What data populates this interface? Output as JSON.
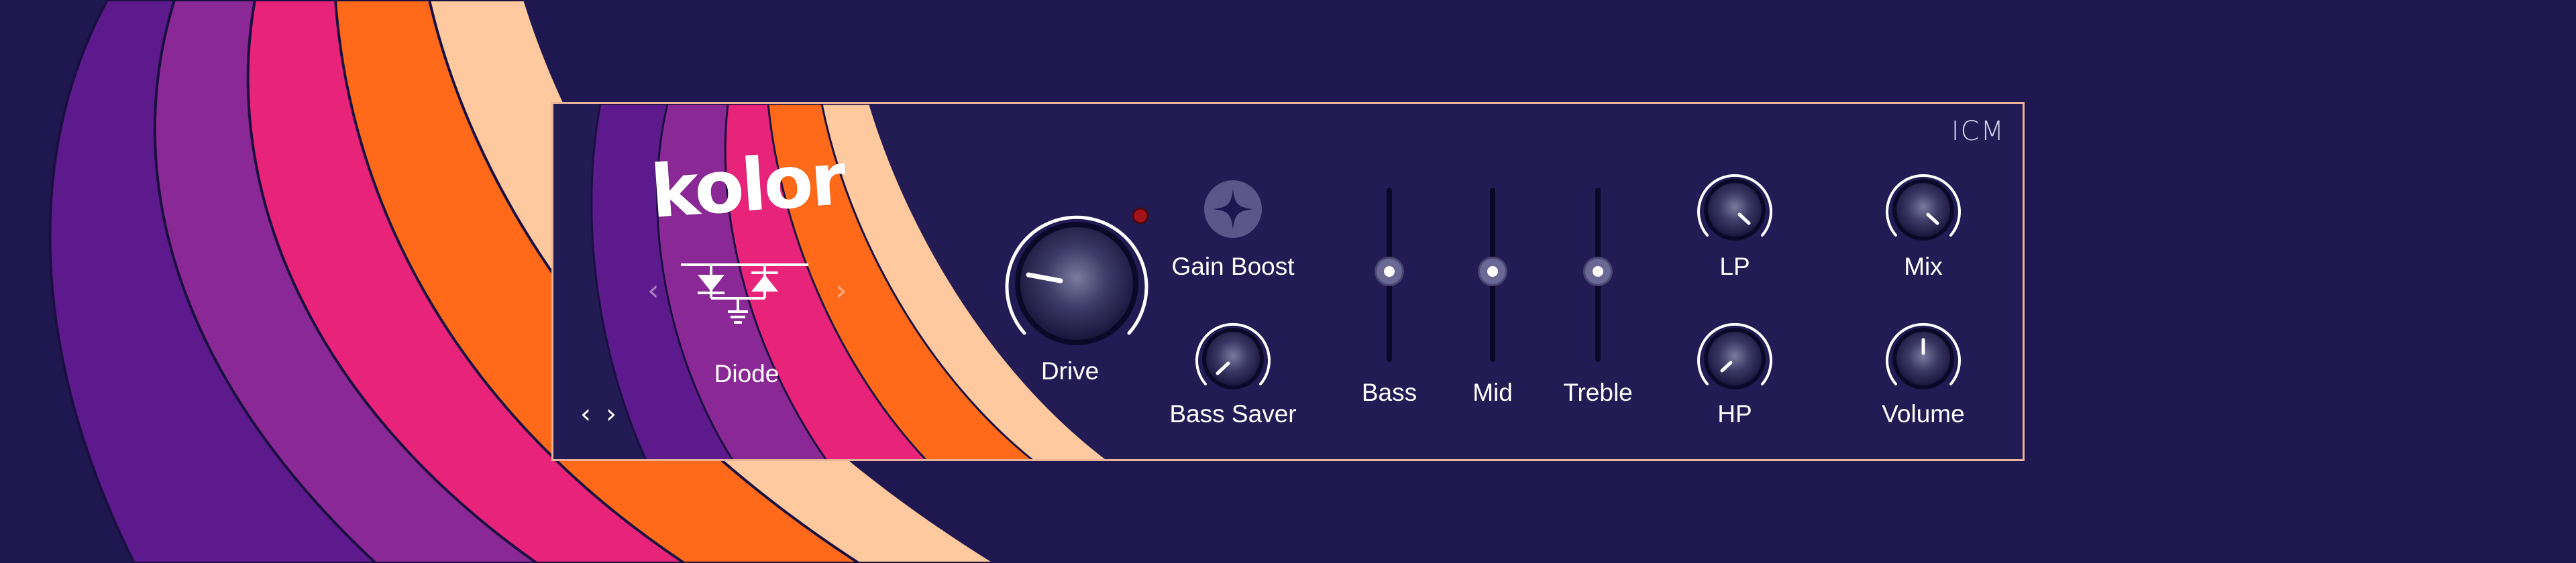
{
  "app": {
    "brand": "ICM",
    "logo": "kolor"
  },
  "colors": {
    "background": "#1f1850",
    "panel_bg": "#221b54",
    "panel_border": "#e8b39a",
    "stripe_purple": "#5d1a8c",
    "stripe_violet": "#8a2896",
    "stripe_magenta": "#e8237a",
    "stripe_orange": "#ff6a1a",
    "stripe_peach": "#ffc9a0",
    "led_red": "#a4121a"
  },
  "mode_selector": {
    "selected_label": "Diode",
    "prev_icon": "chevron-left-icon",
    "next_icon": "chevron-right-icon",
    "mode_icon": "diode-circuit-icon"
  },
  "preset_nav": {
    "prev_symbol": "‹",
    "next_symbol": "›"
  },
  "controls": {
    "drive": {
      "label": "Drive"
    },
    "gain_boost": {
      "label": "Gain Boost",
      "icon": "sparkle-icon"
    },
    "bass_saver": {
      "label": "Bass Saver"
    },
    "bass": {
      "label": "Bass",
      "level": 0.5
    },
    "mid": {
      "label": "Mid",
      "level": 0.5
    },
    "treble": {
      "label": "Treble",
      "level": 0.5
    },
    "lp": {
      "label": "LP"
    },
    "hp": {
      "label": "HP"
    },
    "mix": {
      "label": "Mix"
    },
    "volume": {
      "label": "Volume"
    }
  }
}
